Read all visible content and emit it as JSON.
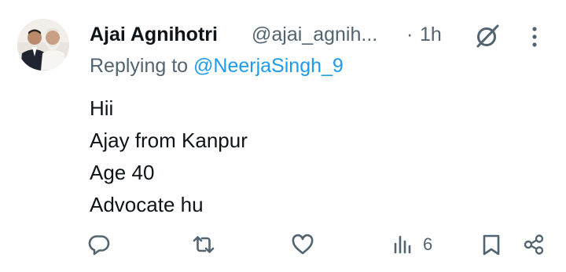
{
  "tweet": {
    "display_name": "Ajai Agnihotri",
    "handle": "@ajai_agnih...",
    "separator": "·",
    "time": "1h",
    "replying_prefix": "Replying to ",
    "replying_to": "@NeerjaSingh_9",
    "lines": [
      "Hii",
      "Ajay from Kanpur",
      "Age 40",
      "Advocate hu"
    ]
  },
  "actions": {
    "reply_icon": "reply-icon",
    "retweet_icon": "retweet-icon",
    "like_icon": "heart-icon",
    "views_icon": "bar-chart-icon",
    "views_count": "6",
    "bookmark_icon": "bookmark-icon",
    "share_icon": "share-icon"
  },
  "colors": {
    "text": "#0f1419",
    "secondary": "#536471",
    "link": "#1d9bf0",
    "background": "#ffffff"
  }
}
